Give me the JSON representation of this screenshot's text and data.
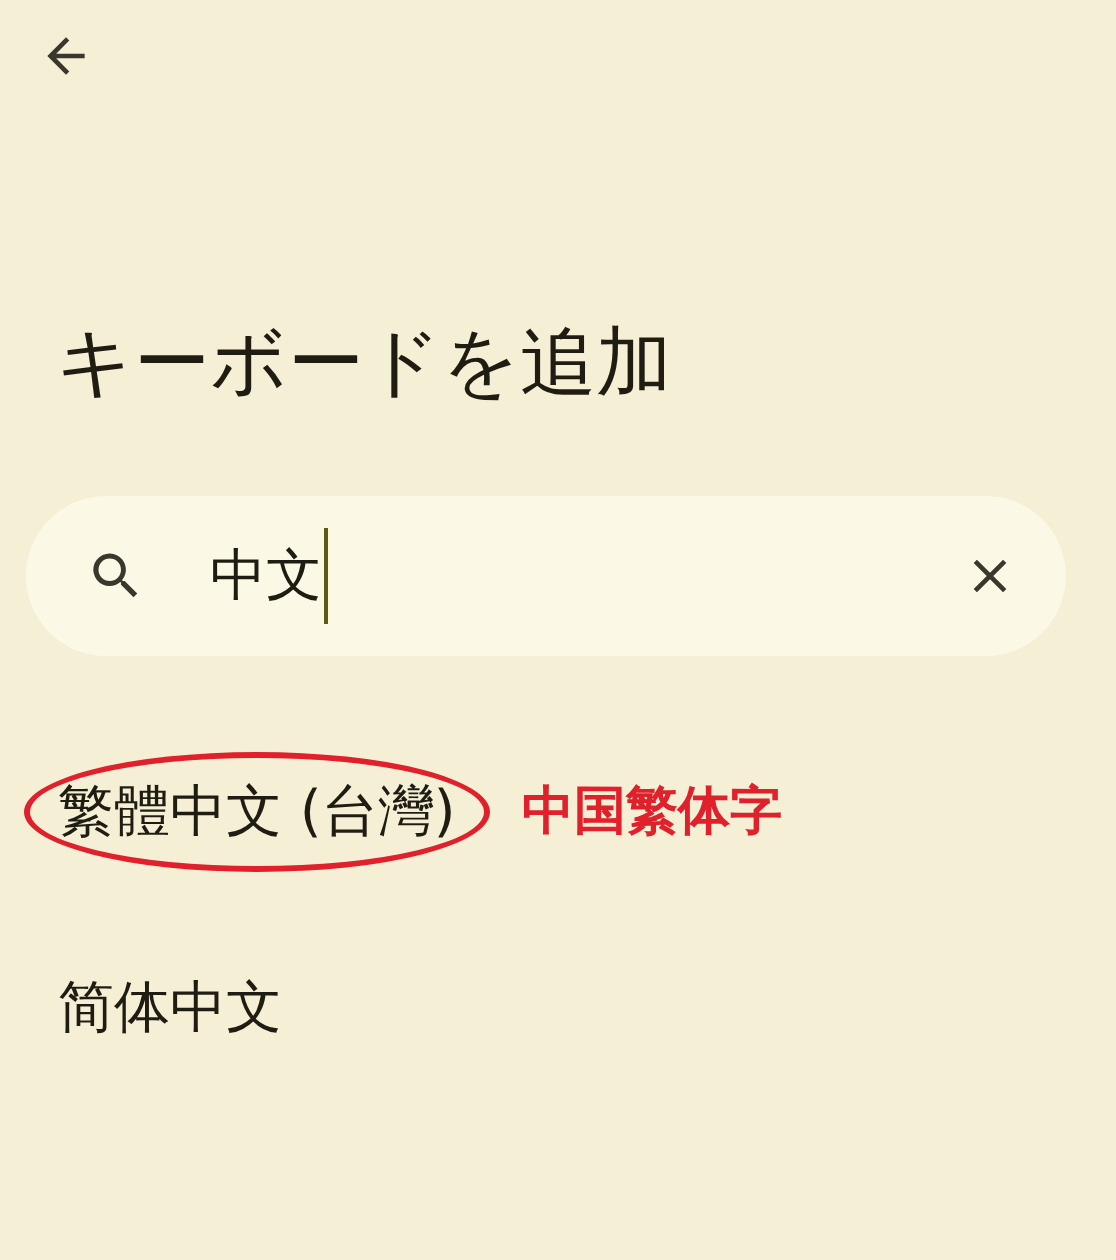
{
  "title": "キーボードを追加",
  "search": {
    "value": "中文"
  },
  "items": [
    {
      "label": "繁體中文 (台灣)",
      "circled": true
    },
    {
      "label": "简体中文",
      "circled": false
    }
  ],
  "annotation": {
    "text": "中国繁体字"
  }
}
